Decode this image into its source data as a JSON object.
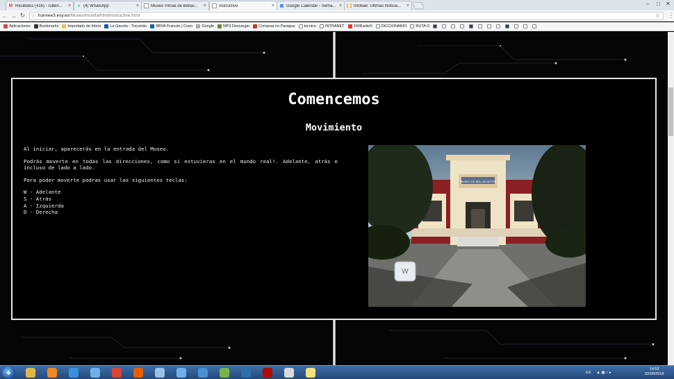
{
  "browser": {
    "tabs": [
      {
        "label": "Recibidos (416) - ruben...",
        "icon": "gmail-icon",
        "color": "#d93025",
        "glyph": "M",
        "active": false
      },
      {
        "label": "(4) WhatsApp",
        "icon": "whatsapp-icon",
        "color": "#25d366",
        "glyph": "●",
        "active": false
      },
      {
        "label": "Museo Virtual de Bellas...",
        "icon": "page-icon",
        "color": "#999999",
        "glyph": "",
        "active": false
      },
      {
        "label": "Instructivo",
        "icon": "page-icon",
        "color": "#999999",
        "glyph": "",
        "active": true
      },
      {
        "label": "Google Calendar - Sema...",
        "icon": "calendar-icon",
        "color": "#4285f4",
        "glyph": "▦",
        "active": false
      },
      {
        "label": "Infobae: Últimas Noticia...",
        "icon": "infobae-icon",
        "color": "#f5a300",
        "glyph": "❙❙",
        "active": false
      }
    ],
    "url": {
      "host": "hunvee3.esy.es",
      "path": "/Museo/muvifa/html/instructive.html"
    },
    "bookmarks": [
      {
        "label": "Aplicaciones",
        "icon": "apps-icon",
        "color": "#d44"
      },
      {
        "label": "Bookmarks",
        "icon": "star-icon",
        "color": "#333"
      },
      {
        "label": "Importado de Intern",
        "icon": "folder-icon",
        "color": "#e8c35c"
      },
      {
        "label": "La Gaceta - Tucumán",
        "icon": "lagaceta-icon",
        "color": "#1d5aa8"
      },
      {
        "label": "BBVA Francés | Cuen",
        "icon": "bbva-icon",
        "color": "#1464a5"
      },
      {
        "label": "Google",
        "icon": "google-icon",
        "color": "#aaa"
      },
      {
        "label": "MP3 Descargar",
        "icon": "mp3-icon",
        "color": "#6a8b2e"
      },
      {
        "label": "Compras no Paragua",
        "icon": "pin-icon",
        "color": "#c0392b"
      },
      {
        "label": "tecnico",
        "icon": "doc-icon",
        "color": "#fff"
      },
      {
        "label": "INTRANET",
        "icon": "doc-icon",
        "color": "#fff"
      },
      {
        "label": "100RadioS",
        "icon": "radio-icon",
        "color": "#e33"
      },
      {
        "label": "DICCIONARIO",
        "icon": "doc-icon",
        "color": "#fff"
      },
      {
        "label": "RUTA O",
        "icon": "doc-icon",
        "color": "#fff"
      }
    ]
  },
  "page": {
    "title": "Comencemos",
    "subtitle": "Movimiento",
    "paragraphs": [
      "Al iniciar, aparecerás en la entrada del Museo.",
      "Podrás moverte en todas las direcciones, como si estuvieras en el mundo real!. Adelante, atrás e incluso de lado a lado.",
      "Para poder moverte podras usar las siguientes teclas:"
    ],
    "keys": [
      "W - Adelante",
      "S - Atrás",
      "A - Izquierda",
      "D - Derecha"
    ],
    "image": {
      "key_label": "W",
      "sign_text": "MUSEO DE BELLAS ARTES"
    }
  },
  "taskbar": {
    "apps": [
      {
        "name": "explorer-icon",
        "color": "#e0b64c"
      },
      {
        "name": "media-player-icon",
        "color": "#f08a24"
      },
      {
        "name": "internet-explorer-icon",
        "color": "#3a8fdc"
      },
      {
        "name": "app-icon",
        "color": "#6fb0e8"
      },
      {
        "name": "chrome-icon",
        "color": "#db4437"
      },
      {
        "name": "firefox-icon",
        "color": "#e66000"
      },
      {
        "name": "app-icon",
        "color": "#9bc2e6"
      },
      {
        "name": "app-icon",
        "color": "#6fb0e8"
      },
      {
        "name": "app-icon",
        "color": "#4a8fd1"
      },
      {
        "name": "grid-app-icon",
        "color": "#7bb34a"
      },
      {
        "name": "photoshop-icon",
        "color": "#2d6fa8"
      },
      {
        "name": "acrobat-icon",
        "color": "#b30b00"
      },
      {
        "name": "pdf-icon",
        "color": "#d9d9d9"
      },
      {
        "name": "sticky-notes-icon",
        "color": "#f3e27a"
      }
    ],
    "lang": "ES",
    "time": "14:52",
    "date": "02/05/2018"
  }
}
